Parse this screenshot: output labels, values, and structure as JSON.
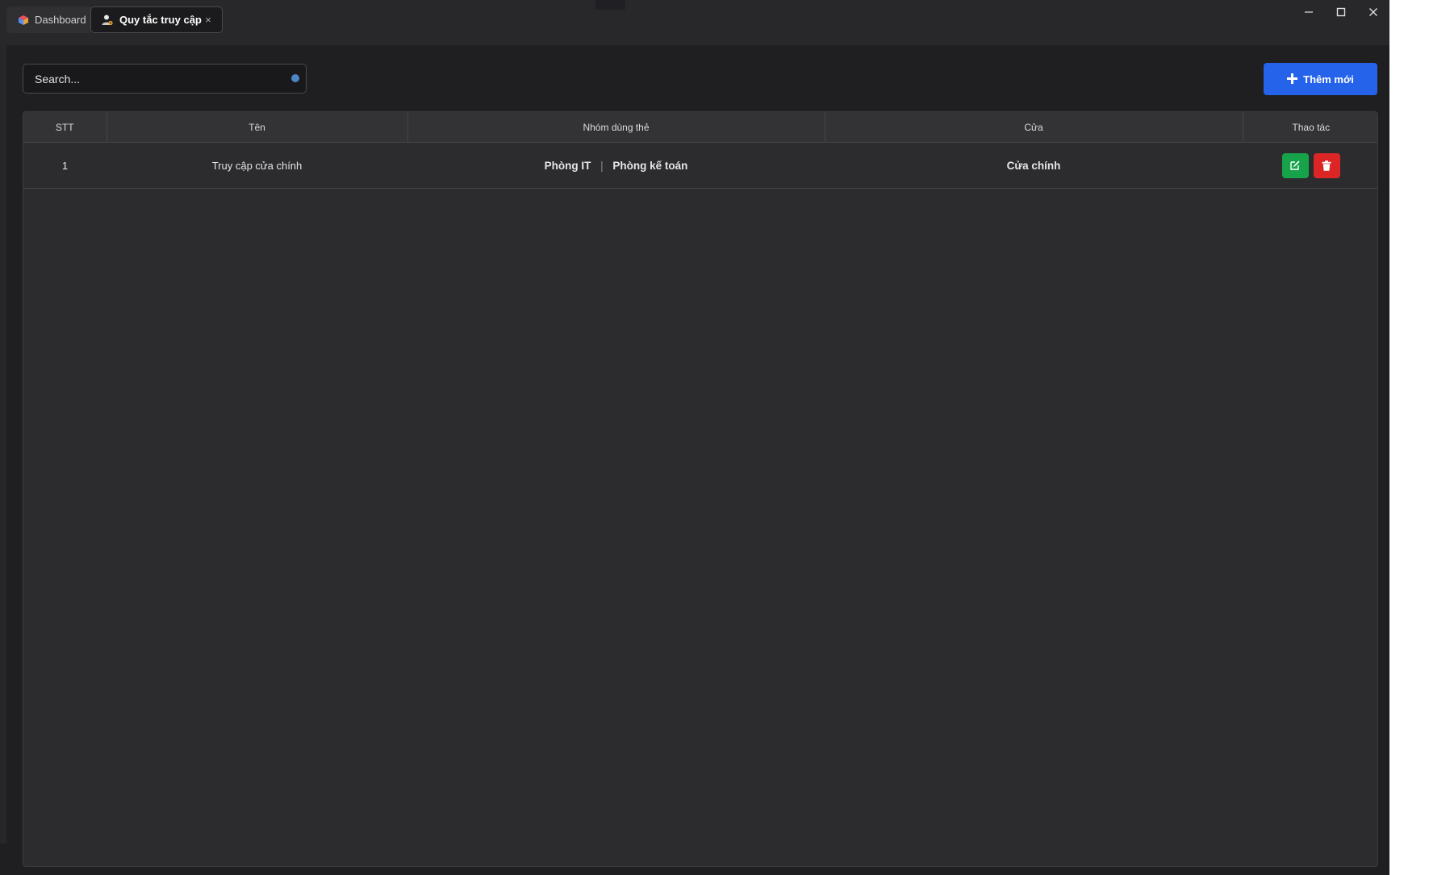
{
  "window": {
    "tabs": [
      {
        "label": "Dashboard",
        "icon": "cube-icon",
        "active": false
      },
      {
        "label": "Quy tắc truy cập",
        "icon": "user-settings-icon",
        "active": true,
        "close_label": "×"
      }
    ],
    "controls": [
      "minimize-icon",
      "maximize-icon",
      "close-icon"
    ]
  },
  "toolbar": {
    "search_placeholder": "Search...",
    "add_label": "Thêm mới",
    "add_color": "#2563eb"
  },
  "table": {
    "columns": [
      "STT",
      "Tên",
      "Nhóm dùng thẻ",
      "Cửa",
      "Thao tác"
    ],
    "rows": [
      {
        "stt": "1",
        "name": "Truy cập cửa chính",
        "groups": [
          "Phòng IT",
          "Phòng kế toán"
        ],
        "group_separator": "|",
        "door": "Cửa chính",
        "actions": [
          {
            "icon": "edit-icon",
            "color": "#16a34a"
          },
          {
            "icon": "trash-icon",
            "color": "#dc2626"
          }
        ]
      }
    ]
  }
}
